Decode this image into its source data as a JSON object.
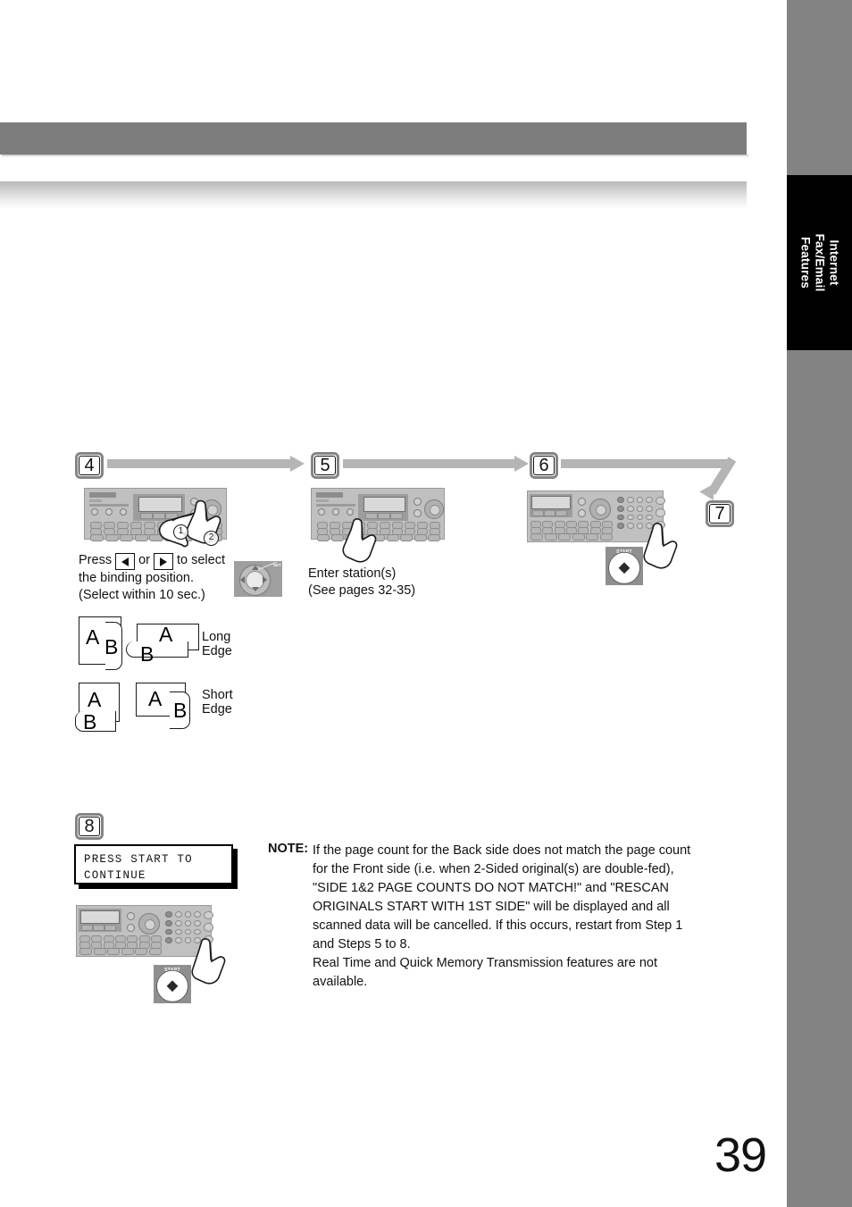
{
  "page": {
    "number": "39",
    "side_tab": "Internet Fax/Email\nFeatures"
  },
  "steps": [
    {
      "badge": "4",
      "caption_pre": "Press",
      "caption_mid": "or",
      "caption_post": "to select",
      "caption_rest": "the binding position.\n(Select within 10 sec.)",
      "key_left_icon": "arrow-left-icon",
      "key_right_icon": "arrow-right-icon",
      "navkey_set_label": "SET"
    },
    {
      "badge": "5",
      "caption": "Enter station(s)\n(See pages 32-35)"
    },
    {
      "badge": "6",
      "start_label": "START"
    },
    {
      "badge": "7"
    },
    {
      "badge": "8",
      "start_label": "START"
    }
  ],
  "binding": {
    "long_edge": {
      "label": "Long Edge",
      "front_letter": "A",
      "back_letter": "B"
    },
    "short_edge": {
      "label": "Short Edge",
      "front_letter": "A",
      "back_letter": "B"
    }
  },
  "lcd_message": {
    "line1": "PRESS START TO",
    "line2": "CONTINUE"
  },
  "note": {
    "label": "NOTE:",
    "paragraph1": "If the page count for the Back side does not match the page count for the Front side (i.e. when 2-Sided original(s) are double-fed), \"SIDE 1&2 PAGE COUNTS DO NOT MATCH!\" and \"RESCAN ORIGINALS START WITH 1ST SIDE\" will be displayed and all scanned data will be cancelled. If this occurs, restart from Step 1 and Steps 5 to 8.",
    "paragraph2": "Real Time and Quick Memory Transmission features are not available."
  },
  "colors": {
    "header_bar": "#7d7d7d",
    "side_column": "#838383",
    "side_tab": "#000000",
    "flow_arrow": "#b5b5b5",
    "panel_body": "#c0c0c0"
  }
}
